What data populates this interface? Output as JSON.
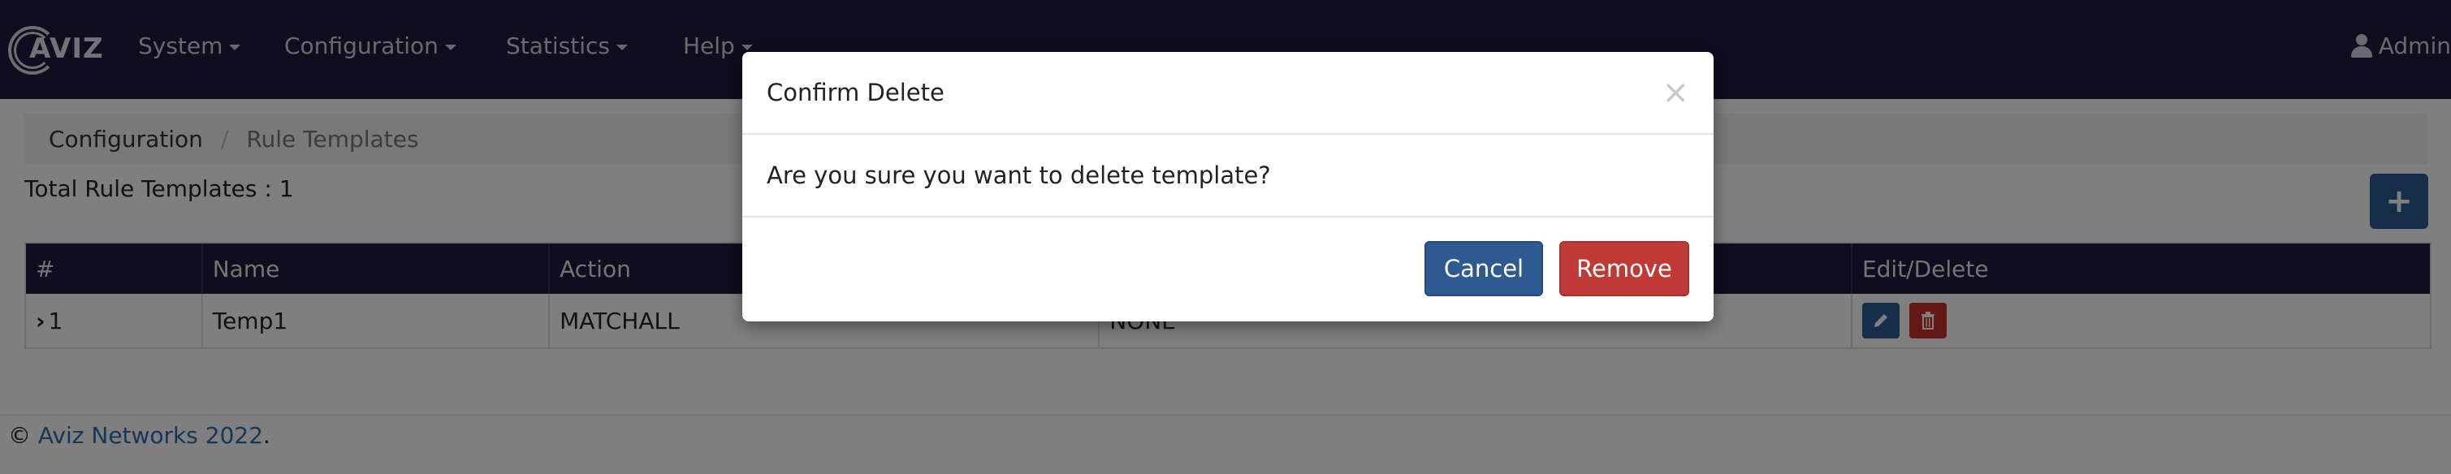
{
  "navbar": {
    "logo_text": "AVIZ",
    "items": [
      {
        "label": "System"
      },
      {
        "label": "Configuration"
      },
      {
        "label": "Statistics"
      },
      {
        "label": "Help"
      }
    ],
    "user_label": "Admin"
  },
  "breadcrumb": {
    "parent": "Configuration",
    "separator": "/",
    "current": "Rule Templates"
  },
  "summary": {
    "total_label": "Total Rule Templates : 1",
    "add_label": "+"
  },
  "table": {
    "headers": [
      "#",
      "Name",
      "Action",
      "",
      "Edit/Delete"
    ],
    "rows": [
      {
        "index": "1",
        "expander": "›",
        "name": "Temp1",
        "action": "MATCHALL",
        "col4": "NONE"
      }
    ]
  },
  "footer": {
    "prefix": "©",
    "link": "Aviz Networks 2022",
    "suffix": "."
  },
  "modal": {
    "title": "Confirm Delete",
    "close": "×",
    "message": "Are you sure you want to delete template?",
    "cancel_label": "Cancel",
    "remove_label": "Remove"
  },
  "colors": {
    "navbar": "#1f1b3d",
    "primary": "#2c5d95",
    "danger": "#c9302c",
    "link": "#2c6fb0"
  }
}
